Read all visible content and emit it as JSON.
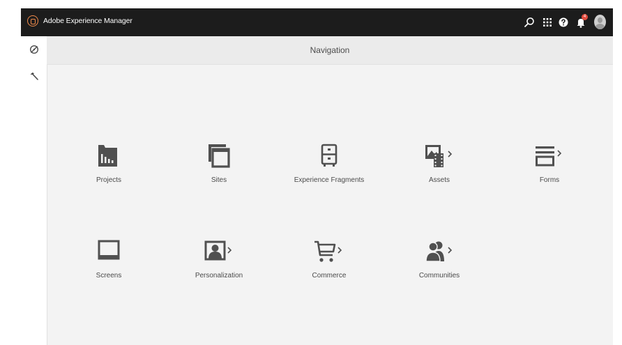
{
  "app": {
    "title": "Adobe Experience Manager"
  },
  "header": {
    "notification_count": "4"
  },
  "page": {
    "title": "Navigation"
  },
  "tiles": [
    {
      "label": "Projects",
      "icon": "projects-icon",
      "has_children": false
    },
    {
      "label": "Sites",
      "icon": "sites-icon",
      "has_children": false
    },
    {
      "label": "Experience Fragments",
      "icon": "experience-fragments-icon",
      "has_children": false
    },
    {
      "label": "Assets",
      "icon": "assets-icon",
      "has_children": true
    },
    {
      "label": "Forms",
      "icon": "forms-icon",
      "has_children": true
    },
    {
      "label": "Screens",
      "icon": "screens-icon",
      "has_children": false
    },
    {
      "label": "Personalization",
      "icon": "personalization-icon",
      "has_children": true
    },
    {
      "label": "Commerce",
      "icon": "commerce-icon",
      "has_children": true
    },
    {
      "label": "Communities",
      "icon": "communities-icon",
      "has_children": true
    }
  ],
  "colors": {
    "topbar": "#1c1c1c",
    "accent": "#f08a4b",
    "icon": "#505050",
    "badge": "#e14b3e"
  }
}
